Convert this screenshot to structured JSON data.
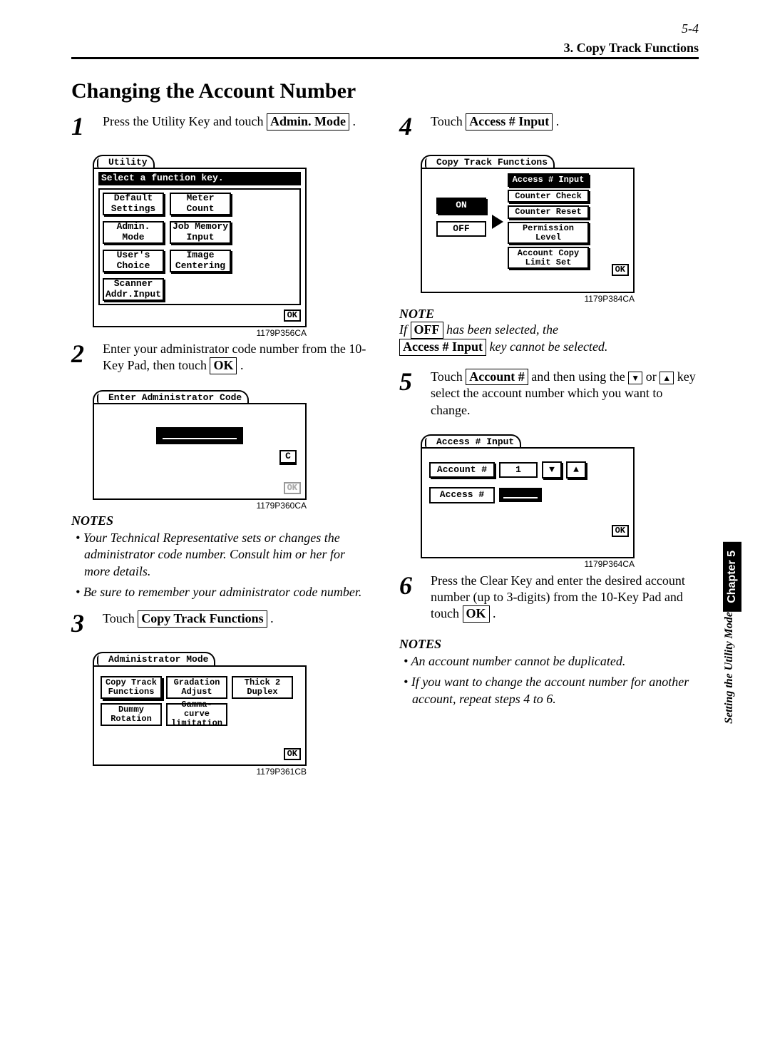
{
  "header": {
    "page_num": "5-4",
    "section": "3. Copy Track Functions"
  },
  "title": "Changing the Account Number",
  "steps": {
    "s1": {
      "num": "1",
      "text_a": "Press the Utility Key and touch ",
      "btn": "Admin. Mode",
      "text_b": " ."
    },
    "s2": {
      "num": "2",
      "text_a": "Enter your administrator code number from the 10-Key Pad, then touch ",
      "btn": "OK",
      "text_b": " ."
    },
    "s3": {
      "num": "3",
      "text_a": "Touch ",
      "btn": "Copy Track Functions",
      "text_b": " ."
    },
    "s4": {
      "num": "4",
      "text_a": "Touch ",
      "btn": "Access # Input",
      "text_b": " ."
    },
    "s5": {
      "num": "5",
      "text_a": "Touch ",
      "btn": "Account #",
      "text_b": " and then using the ",
      "text_c": " or ",
      "text_d": " key select the account number which you want to change."
    },
    "s6": {
      "num": "6",
      "text_a": "Press the Clear Key and enter the desired account number (up to 3-digits) from the 10-Key Pad and touch ",
      "btn": "OK",
      "text_b": " ."
    }
  },
  "notes_left_head": "NOTES",
  "notes_left": [
    "Your Technical Representative sets or changes the administrator code number. Consult him or her for more details.",
    "Be sure to remember your administrator code number."
  ],
  "note4_head": "NOTE",
  "note4_a": "If ",
  "note4_btn1": "OFF",
  "note4_b": " has been selected, the ",
  "note4_btn2": "Access # Input",
  "note4_c": " key cannot be selected.",
  "notes_right_head": "NOTES",
  "notes_right": [
    "An account number cannot be duplicated.",
    "If you want to change the account number for another account, repeat steps 4 to 6."
  ],
  "screen1": {
    "title": "Utility",
    "sub": "Select a function key.",
    "cells": [
      "Default Settings",
      "Meter Count",
      "Admin. Mode",
      "Job Memory Input",
      "User's Choice",
      "Image Centering",
      "Scanner Addr.Input"
    ],
    "ok": "OK",
    "caption": "1179P356CA"
  },
  "screen2": {
    "title": "Enter Administrator Code",
    "c": "C",
    "ok": "OK",
    "caption": "1179P360CA"
  },
  "screen3": {
    "title": "Administrator Mode",
    "cells": [
      "Copy Track Functions",
      "Gradation Adjust",
      "Thick 2 Duplex",
      "Dummy Rotation",
      "Gamma- curve limitation"
    ],
    "ok": "OK",
    "caption": "1179P361CB"
  },
  "screen4": {
    "title": "Copy Track Functions",
    "on": "ON",
    "off": "OFF",
    "opts": [
      "Access # Input",
      "Counter Check",
      "Counter Reset",
      "Permission Level",
      "Account Copy Limit Set"
    ],
    "ok": "OK",
    "caption": "1179P384CA"
  },
  "screen5": {
    "title": "Access # Input",
    "account_lbl": "Account #",
    "account_val": "1",
    "down": "▼",
    "up": "▲",
    "access_lbl": "Access #",
    "ok": "OK",
    "caption": "1179P364CA"
  },
  "sidetab": {
    "chapter": "Chapter 5",
    "desc": "Setting the Utility Mode"
  }
}
